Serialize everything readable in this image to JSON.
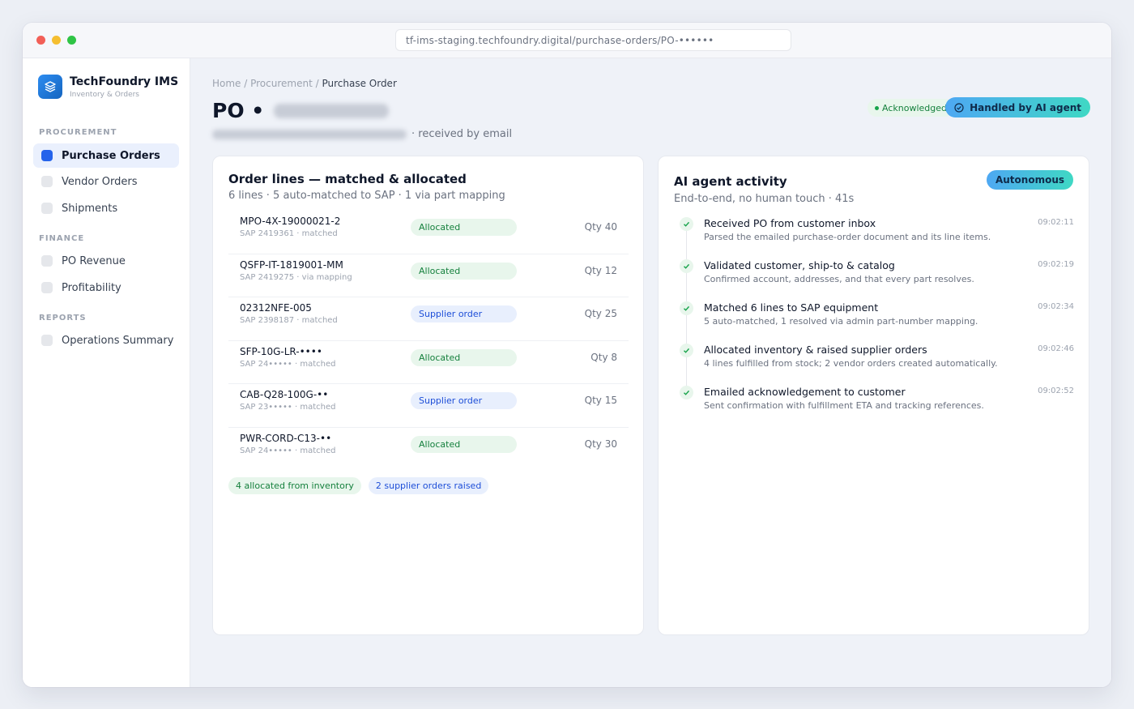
{
  "browser": {
    "url": "tf-ims-staging.techfoundry.digital/purchase-orders/PO-••••••"
  },
  "sidebar": {
    "brand": {
      "name": "TechFoundry IMS",
      "subtitle": "Inventory & Orders"
    },
    "sections": [
      {
        "label": "PROCUREMENT",
        "items": [
          {
            "label": "Purchase Orders",
            "active": true
          },
          {
            "label": "Vendor Orders",
            "active": false
          },
          {
            "label": "Shipments",
            "active": false
          }
        ]
      },
      {
        "label": "FINANCE",
        "items": [
          {
            "label": "PO Revenue",
            "active": false
          },
          {
            "label": "Profitability",
            "active": false
          }
        ]
      },
      {
        "label": "REPORTS",
        "items": [
          {
            "label": "Operations Summary",
            "active": false
          }
        ]
      }
    ]
  },
  "header": {
    "breadcrumb": {
      "home": "Home",
      "section": "Procurement",
      "current": "Purchase Order",
      "sep": " / "
    },
    "title_prefix": "PO •",
    "subtitle_suffix": "· received by email",
    "status_badge": "Acknowledged",
    "ai_badge": "Handled by AI agent"
  },
  "order_lines": {
    "title": "Order lines — matched & allocated",
    "subtitle": "6 lines · 5 auto-matched to SAP · 1 via part mapping",
    "rows": [
      {
        "part": "MPO-4X-19000021-2",
        "sap": "SAP 2419361 · matched",
        "status": "Allocated",
        "qty": "Qty 40"
      },
      {
        "part": "QSFP-IT-1819001-MM",
        "sap": "SAP 2419275 · via mapping",
        "status": "Allocated",
        "qty": "Qty 12"
      },
      {
        "part": "02312NFE-005",
        "sap": "SAP 2398187 · matched",
        "status": "Supplier order",
        "qty": "Qty 25"
      },
      {
        "part": "SFP-10G-LR-••••",
        "sap": "SAP 24••••• · matched",
        "status": "Allocated",
        "qty": "Qty 8"
      },
      {
        "part": "CAB-Q28-100G-••",
        "sap": "SAP 23••••• · matched",
        "status": "Supplier order",
        "qty": "Qty 15"
      },
      {
        "part": "PWR-CORD-C13-••",
        "sap": "SAP 24••••• · matched",
        "status": "Allocated",
        "qty": "Qty 30"
      }
    ],
    "summary": {
      "allocated": "4 allocated from inventory",
      "supplier": "2 supplier orders raised"
    }
  },
  "agent_activity": {
    "title": "AI agent activity",
    "subtitle": "End-to-end, no human touch · 41s",
    "badge": "Autonomous",
    "events": [
      {
        "title": "Received PO from customer inbox",
        "desc": "Parsed the emailed purchase-order document and its line items.",
        "time": "09:02:11"
      },
      {
        "title": "Validated customer, ship-to & catalog",
        "desc": "Confirmed account, addresses, and that every part resolves.",
        "time": "09:02:19"
      },
      {
        "title": "Matched 6 lines to SAP equipment",
        "desc": "5 auto-matched, 1 resolved via admin part-number mapping.",
        "time": "09:02:34"
      },
      {
        "title": "Allocated inventory & raised supplier orders",
        "desc": "4 lines fulfilled from stock; 2 vendor orders created automatically.",
        "time": "09:02:46"
      },
      {
        "title": "Emailed acknowledgement to customer",
        "desc": "Sent confirmation with fulfillment ETA and tracking references.",
        "time": "09:02:52"
      }
    ]
  },
  "colors": {
    "accent": "#2563eb",
    "success": "#15803d",
    "success_bg": "#e8f6ec",
    "info": "#1d4ed8",
    "info_bg": "#e8effd",
    "ai_gradient_start": "#4ea8f3",
    "ai_gradient_end": "#3fd8c4"
  },
  "icons": {
    "brand": "layers-icon",
    "ai_badge": "check-circle-icon",
    "event": "check-icon"
  }
}
